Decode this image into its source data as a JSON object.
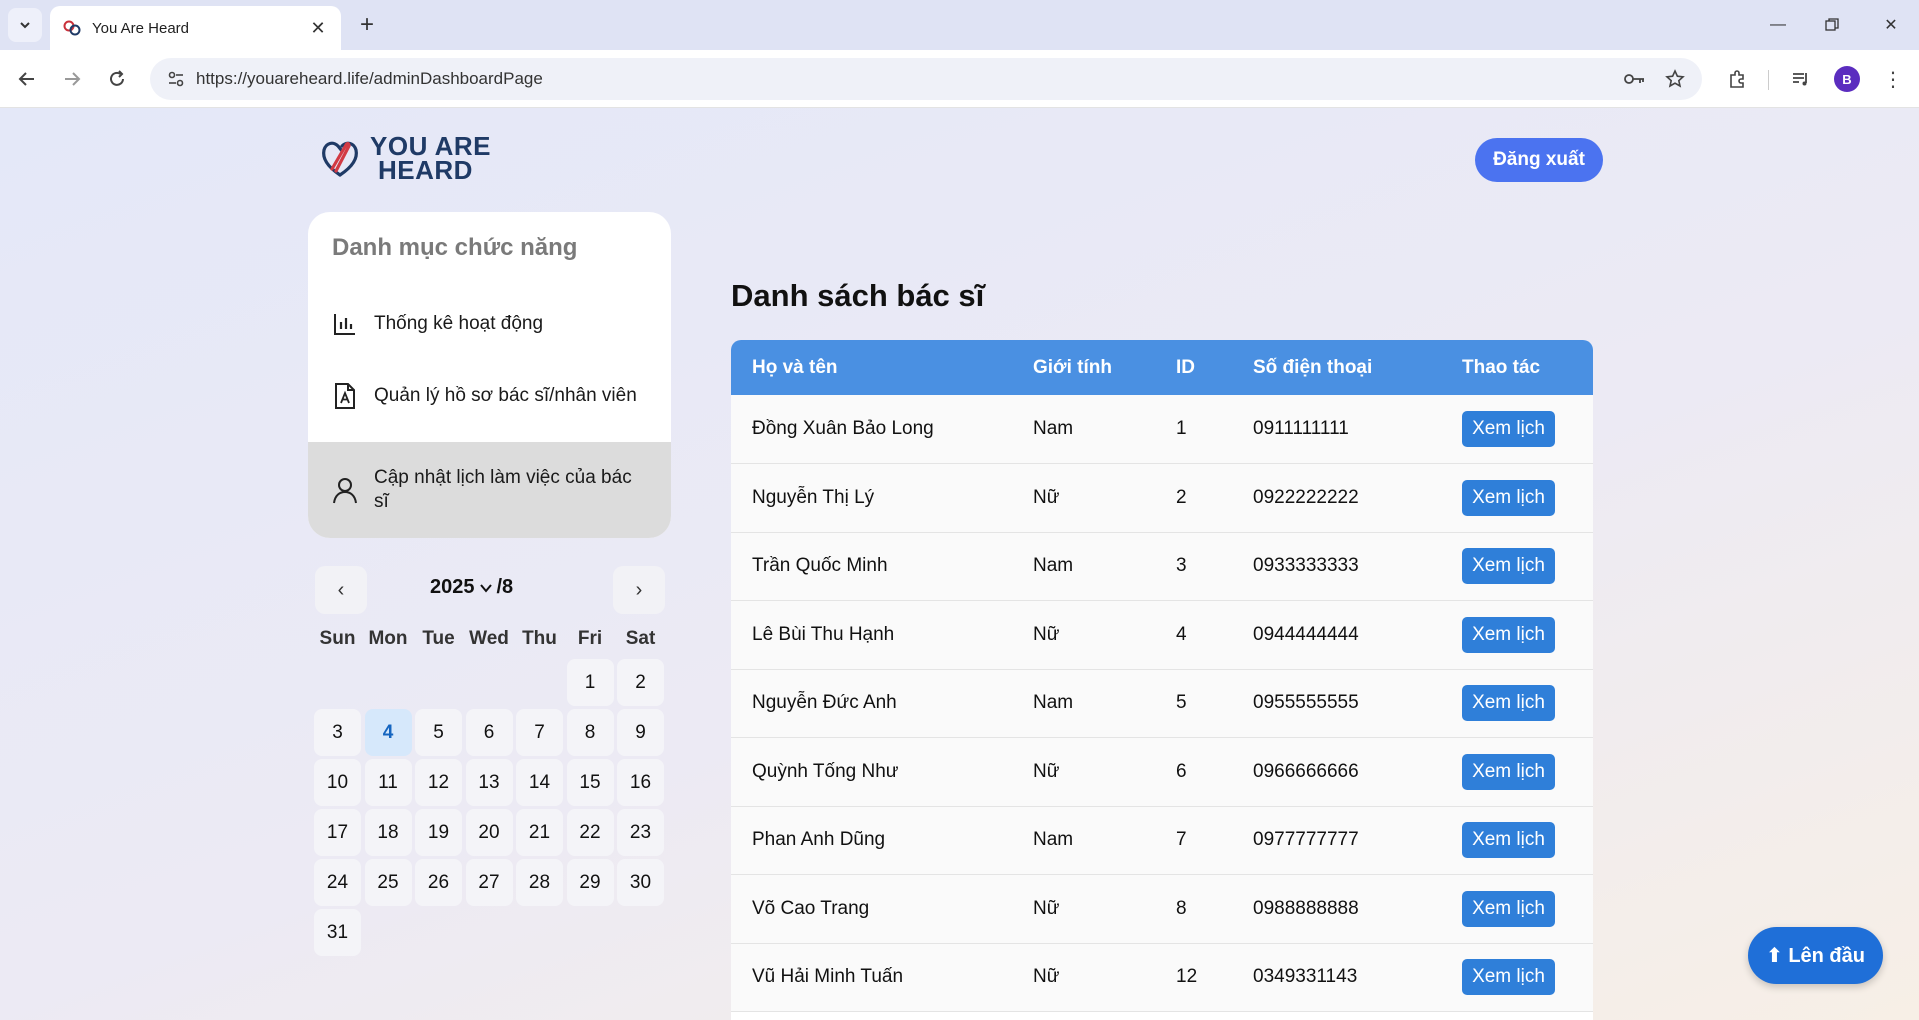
{
  "browser": {
    "tab_title": "You Are Heard",
    "url": "https://youareheard.life/adminDashboardPage",
    "profile_initial": "B"
  },
  "header": {
    "logo_line1": "YOU ARE",
    "logo_line2": "HEARD",
    "logout_label": "Đăng xuất"
  },
  "sidebar": {
    "heading": "Danh mục chức năng",
    "items": [
      {
        "label": "Thống kê hoạt động",
        "icon": "bar-chart-icon"
      },
      {
        "label": "Quản lý hồ sơ bác sĩ/nhân viên",
        "icon": "document-icon"
      },
      {
        "label": "Cập nhật lịch làm việc của bác sĩ",
        "icon": "user-icon",
        "active": true
      }
    ]
  },
  "calendar": {
    "year": "2025",
    "month_label": "/8",
    "prev": "‹",
    "next": "›",
    "weekdays": [
      "Sun",
      "Mon",
      "Tue",
      "Wed",
      "Thu",
      "Fri",
      "Sat"
    ],
    "leading_blanks": 5,
    "days": [
      "1",
      "2",
      "3",
      "4",
      "5",
      "6",
      "7",
      "8",
      "9",
      "10",
      "11",
      "12",
      "13",
      "14",
      "15",
      "16",
      "17",
      "18",
      "19",
      "20",
      "21",
      "22",
      "23",
      "24",
      "25",
      "26",
      "27",
      "28",
      "29",
      "30",
      "31"
    ],
    "today": "4"
  },
  "main": {
    "title": "Danh sách bác sĩ",
    "columns": [
      "Họ và tên",
      "Giới tính",
      "ID",
      "Số điện thoại",
      "Thao tác"
    ],
    "action_label": "Xem lịch",
    "rows": [
      {
        "name": "Đồng Xuân Bảo Long",
        "gender": "Nam",
        "id": "1",
        "phone": "0911111111"
      },
      {
        "name": "Nguyễn Thị Lý",
        "gender": "Nữ",
        "id": "2",
        "phone": "0922222222"
      },
      {
        "name": "Trần Quốc Minh",
        "gender": "Nam",
        "id": "3",
        "phone": "0933333333"
      },
      {
        "name": "Lê Bùi Thu Hạnh",
        "gender": "Nữ",
        "id": "4",
        "phone": "0944444444"
      },
      {
        "name": "Nguyễn Đức Anh",
        "gender": "Nam",
        "id": "5",
        "phone": "0955555555"
      },
      {
        "name": "Quỳnh Tống Như",
        "gender": "Nữ",
        "id": "6",
        "phone": "0966666666"
      },
      {
        "name": "Phan Anh Dũng",
        "gender": "Nam",
        "id": "7",
        "phone": "0977777777"
      },
      {
        "name": "Võ Cao Trang",
        "gender": "Nữ",
        "id": "8",
        "phone": "0988888888"
      },
      {
        "name": "Vũ Hải Minh Tuấn",
        "gender": "Nữ",
        "id": "12",
        "phone": "0349331143"
      }
    ]
  },
  "scroll_top_label": "⬆ Lên đầu",
  "colors": {
    "accent": "#4b73f0",
    "table_header": "#4a90e2",
    "action_button": "#2f7fd9",
    "today_bg": "#d6e8fb",
    "logo_text": "#1f3a66"
  }
}
